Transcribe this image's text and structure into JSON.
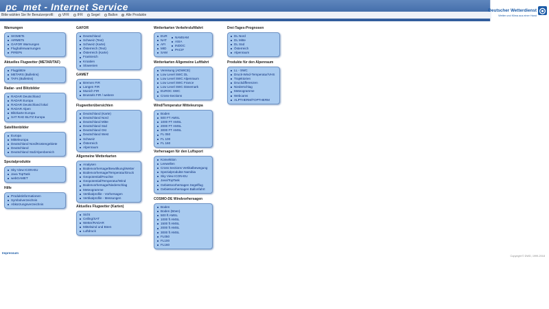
{
  "header": {
    "title": "pc_met - Internet Service",
    "logo_org": "Deutscher Wetterdienst",
    "logo_tagline": "Wetter und Klima aus einer Hand",
    "logo_emblem_icon": "dwd-spiral-logo",
    "logo_badge": "DWD"
  },
  "profile": {
    "label": "Bitte wählen Sie Ihr Benutzerprofil:",
    "options": [
      {
        "label": "VFR",
        "selected": false
      },
      {
        "label": "IFR",
        "selected": false
      },
      {
        "label": "Segel",
        "selected": false
      },
      {
        "label": "Ballon",
        "selected": false
      },
      {
        "label": "Alle Produkte",
        "selected": true
      }
    ]
  },
  "sections": {
    "warnungen": {
      "title": "Warnungen",
      "items": [
        "SIGMETs",
        "AIRMETs",
        "GAFOR Warnungen",
        "Flughafenwarnungen",
        "PIREPs"
      ]
    },
    "flugwetter": {
      "title": "Aktuelles Flugwetter (METAR/TAF)",
      "items": [
        "Flugplätze",
        "METARS (Bulletins)",
        "TAFs (Bulletins)"
      ]
    },
    "radar": {
      "title": "Radar- und Blitzbilder",
      "items": [
        "RADAR Deutschland",
        "RADAR Europa",
        "RADAR Deutschland lokal",
        "RADAR Alpen",
        "Blitzkarte Europa",
        "SAT RAD BLITZ Europa"
      ]
    },
    "satelliten": {
      "title": "Satellitenbilder",
      "items": [
        "Europa",
        "Mitteleuropa",
        "Deutschland Nord/Küstengebiete",
        "Deutschland",
        "Deutschland Süd/Alpenbereich"
      ]
    },
    "spezial": {
      "title": "Spezialprodukte",
      "items": [
        "Sky View ICON-EU",
        "Java TopTask",
        "webGAMET"
      ]
    },
    "hilfe": {
      "title": "Hilfe",
      "items": [
        "Produktinformationen",
        "Symbolverzeichnis",
        "Abkürzungsverzeichnis"
      ]
    },
    "gafor": {
      "title": "GAFOR",
      "items": [
        "Deutschland",
        "Schweiz (Text)",
        "Schweiz (Karte)",
        "Österreich (Text)",
        "Österreich (Karte)",
        "Frankreich",
        "Kroatien",
        "Slowenien"
      ]
    },
    "gamet": {
      "title": "GAMET",
      "items": [
        "Bremen FIR",
        "Langen FIR",
        "Munich FIR",
        "Brussels FIR / weitere"
      ]
    },
    "uebersichten": {
      "title": "Flugwetterübersichten",
      "items": [
        "Deutschland (Karte)",
        "Deutschland Nord",
        "Deutschland Mitte",
        "Deutschland Süd",
        "Deutschland Ost",
        "Deutschland West",
        "Schweiz",
        "Österreich",
        "Alpenraum"
      ]
    },
    "allgemeine": {
      "title": "Allgemeine Wetterkarten",
      "items": [
        "Analysen",
        "Bodenvorhersage/Bewölkung/Wetter",
        "Bodenvorhersage/Temperatur/Druck",
        "Geopotential/Feuchte",
        "Geopotential/Temperatur/Wind",
        "Bodenvorhersage/Niederschlag",
        "Meteogramme",
        "Vertikalprofile - Vorhersagen",
        "Vertikalprofile - Messungen"
      ]
    },
    "aktuelles_karten": {
      "title": "Aktuelles Flugwetter (Karten)",
      "items": [
        "Sicht",
        "Ceiling/SAT",
        "Wetter/RADAR",
        "Mittelwind und Böen",
        "Luftdruck"
      ]
    },
    "verkehr": {
      "title": "Wetterkarten Verkehrsluftfahrt",
      "col1": [
        "EUR",
        "NAT",
        "AFI",
        "MID",
        "SAM"
      ],
      "col2": [
        "NAMSAM",
        "ASIA",
        "INDOC",
        "PACIF"
      ]
    },
    "allg_luftfahrt": {
      "title": "Wetterkarten Allgemeine Luftfahrt",
      "items": [
        "Vereisung (ADWICE)",
        "Low Level SWC DL",
        "Low Level SWC Alpenraum",
        "Low Level SWC France",
        "Low Level SWC Dänemark",
        "EUROC SWC",
        "Cross-Sections"
      ]
    },
    "windtemp": {
      "title": "Wind/Temperatur Mitteleuropa",
      "items": [
        "Boden",
        "500 FT AMSL",
        "1000 FT AMSL",
        "2000 FT AMSL",
        "3000 FT AMSL",
        "FL 050",
        "FL 100",
        "FL 160"
      ]
    },
    "luftsport": {
      "title": "Vorhersagen für den Luftsport",
      "items": [
        "Konvektion",
        "Leewellen",
        "Cross Sections Vertikalbewegung",
        "Spezialprodukte Namibia",
        "Sky View ICON-EU",
        "Java/TopTask",
        "Gebietsvorhersagen Segelflug",
        "Gebietsvorhersagen Ballonfahrt"
      ]
    },
    "cosmo": {
      "title": "COSMO-DE Windvorhersagen",
      "items": [
        "Boden",
        "Boden (Böen)",
        "500 ft AMSL",
        "1000 ft AMSL",
        "1500 ft AMSL",
        "2000 ft AMSL",
        "3000 ft AMSL",
        "FL050",
        "FL100",
        "FL160"
      ]
    },
    "dreitages": {
      "title": "Drei-Tages-Prognosen",
      "items": [
        "DL Nord",
        "DL Mitte",
        "DL Süd",
        "Österreich",
        "Alpenraum"
      ]
    },
    "alpenraum": {
      "title": "Produkte für den Alpenraum",
      "items": [
        "LL - SWC",
        "Druck-Wind-Temperatur/VHS",
        "Trajektorien",
        "Druckdifferenzen",
        "Niederschlag",
        "Meteogramme",
        "Webcams",
        "ALPTHERM/TOPTHERM"
      ]
    }
  },
  "footer": {
    "impressum": "Impressum",
    "copyright": "Copyright © DWD, 1999-2018"
  }
}
